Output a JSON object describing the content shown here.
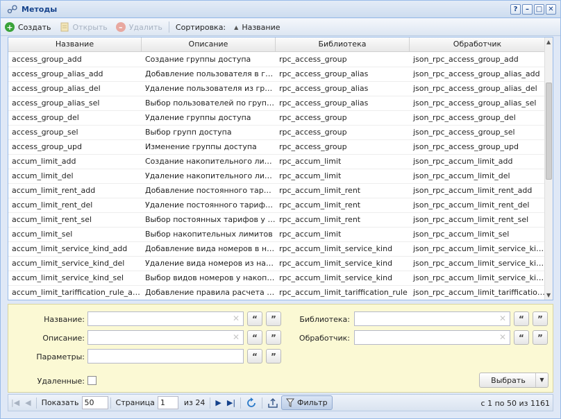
{
  "window": {
    "title": "Методы",
    "buttons": [
      "?",
      "–",
      "□",
      "✕"
    ]
  },
  "toolbar": {
    "create": "Создать",
    "open": "Открыть",
    "delete": "Удалить",
    "sort_label": "Сортировка:",
    "sort_field": "Название"
  },
  "grid": {
    "columns": [
      "Название",
      "Описание",
      "Библиотека",
      "Обработчик"
    ],
    "rows": [
      [
        "access_group_add",
        "Создание группы доступа",
        "rpc_access_group",
        "json_rpc_access_group_add"
      ],
      [
        "access_group_alias_add",
        "Добавление пользователя в групп...",
        "rpc_access_group_alias",
        "json_rpc_access_group_alias_add"
      ],
      [
        "access_group_alias_del",
        "Удаление пользователя из групп...",
        "rpc_access_group_alias",
        "json_rpc_access_group_alias_del"
      ],
      [
        "access_group_alias_sel",
        "Выбор пользователей по группам...",
        "rpc_access_group_alias",
        "json_rpc_access_group_alias_sel"
      ],
      [
        "access_group_del",
        "Удаление группы доступа",
        "rpc_access_group",
        "json_rpc_access_group_del"
      ],
      [
        "access_group_sel",
        "Выбор групп доступа",
        "rpc_access_group",
        "json_rpc_access_group_sel"
      ],
      [
        "access_group_upd",
        "Изменение группы доступа",
        "rpc_access_group",
        "json_rpc_access_group_upd"
      ],
      [
        "accum_limit_add",
        "Создание накопительного лимита",
        "rpc_accum_limit",
        "json_rpc_accum_limit_add"
      ],
      [
        "accum_limit_del",
        "Удаление накопительного лимита",
        "rpc_accum_limit",
        "json_rpc_accum_limit_del"
      ],
      [
        "accum_limit_rent_add",
        "Добавление постоянного тарифа ...",
        "rpc_accum_limit_rent",
        "json_rpc_accum_limit_rent_add"
      ],
      [
        "accum_limit_rent_del",
        "Удаление постоянного тарифа из...",
        "rpc_accum_limit_rent",
        "json_rpc_accum_limit_rent_del"
      ],
      [
        "accum_limit_rent_sel",
        "Выбор постоянных тарифов у нак...",
        "rpc_accum_limit_rent",
        "json_rpc_accum_limit_rent_sel"
      ],
      [
        "accum_limit_sel",
        "Выбор накопительных лимитов",
        "rpc_accum_limit",
        "json_rpc_accum_limit_sel"
      ],
      [
        "accum_limit_service_kind_add",
        "Добавление вида номеров в нако...",
        "rpc_accum_limit_service_kind",
        "json_rpc_accum_limit_service_kind..."
      ],
      [
        "accum_limit_service_kind_del",
        "Удаление вида номеров из накоп...",
        "rpc_accum_limit_service_kind",
        "json_rpc_accum_limit_service_kind..."
      ],
      [
        "accum_limit_service_kind_sel",
        "Выбор видов номеров у накопите...",
        "rpc_accum_limit_service_kind",
        "json_rpc_accum_limit_service_kind..."
      ],
      [
        "accum_limit_tariffication_rule_add",
        "Добавление правила расчета в н...",
        "rpc_accum_limit_tariffication_rule",
        "json_rpc_accum_limit_tariffication..."
      ]
    ]
  },
  "filter": {
    "name_label": "Название:",
    "description_label": "Описание:",
    "params_label": "Параметры:",
    "library_label": "Библиотека:",
    "handler_label": "Обработчик:",
    "deleted_label": "Удаленные:",
    "select_button": "Выбрать",
    "quote_open": "“",
    "quote_close": "”"
  },
  "pager": {
    "show_label": "Показать",
    "page_size": "50",
    "page_label": "Страница",
    "page": "1",
    "of_pages": "из 24",
    "filter_button": "Фильтр",
    "info": "с 1 по 50 из 1161"
  },
  "colors": {
    "title": "#15428b",
    "filter_bg": "#fbf9d4",
    "create_icon": "#3aa33a",
    "delete_icon": "#d04a3a"
  }
}
